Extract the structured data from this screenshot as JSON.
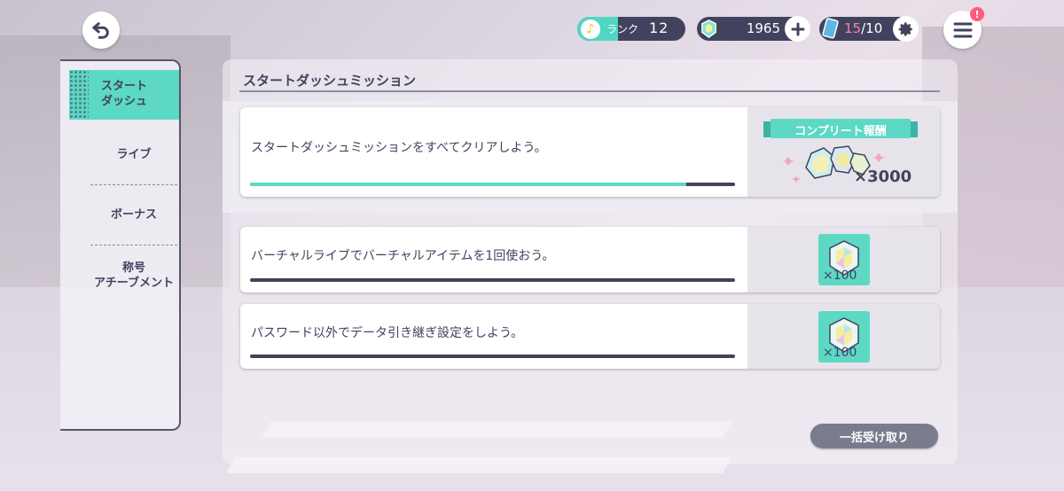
{
  "header": {
    "rank_label": "ランク",
    "rank_value": "12",
    "crystals": "1965",
    "bonus_current": "15",
    "bonus_max": "/10",
    "alert": "!"
  },
  "sidebar": {
    "items": [
      {
        "label": "スタート\nダッシュ",
        "active": true
      },
      {
        "label": "ライブ",
        "active": false
      },
      {
        "label": "ボーナス",
        "active": false
      },
      {
        "label": "称号\nアチーブメント",
        "active": false
      }
    ]
  },
  "main": {
    "title": "スタートダッシュミッション",
    "complete_mission": {
      "text": "スタートダッシュミッションをすべてクリアしよう。",
      "progress": 0.9,
      "reward_banner": "コンプリート報酬",
      "reward_count": "×3000"
    },
    "missions": [
      {
        "text": "バーチャルライブでバーチャルアイテムを1回使おう。",
        "progress": 0,
        "reward_count": "×100"
      },
      {
        "text": "パスワード以外でデータ引き継ぎ設定をしよう。",
        "progress": 0,
        "reward_count": "×100"
      }
    ],
    "claim_all_label": "一括受け取り"
  },
  "colors": {
    "accent": "#5cd8c5",
    "navy": "#41435e",
    "pink": "#ff7fa9"
  }
}
